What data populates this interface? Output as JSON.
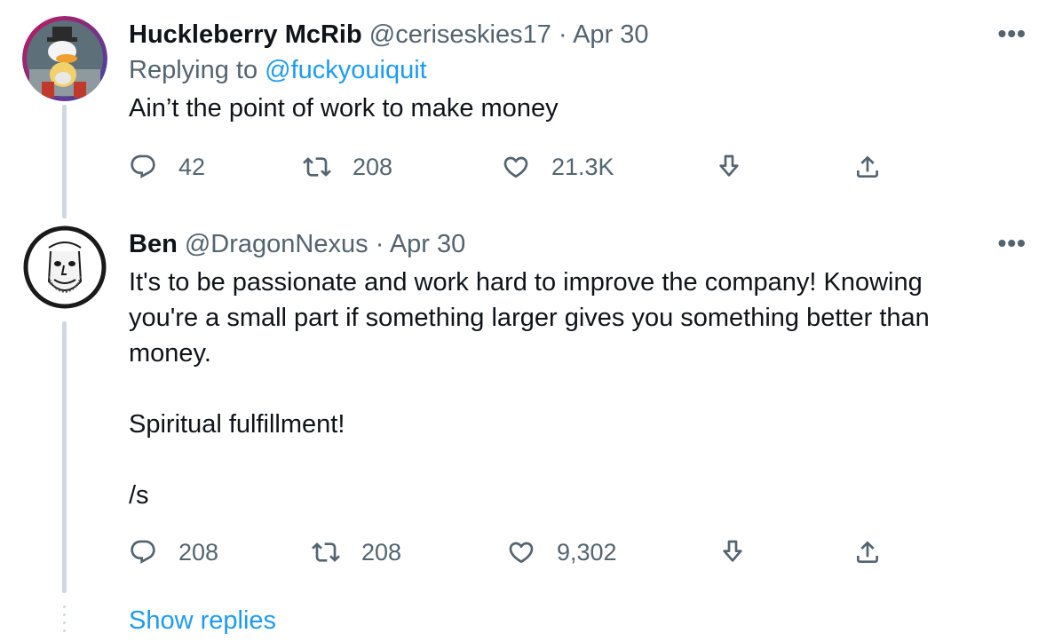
{
  "tweets": [
    {
      "name": "Huckleberry McRib",
      "handle": "@ceriseskies17",
      "date": "Apr 30",
      "replying_prefix": "Replying to",
      "replying_to": "@fuckyouiquit",
      "text": "Ain’t the point of work to make money",
      "reply_count": "42",
      "retweet_count": "208",
      "like_count": "21.3K",
      "avatar_icon": "cartoon-duck-avatar"
    },
    {
      "name": "Ben",
      "handle": "@DragonNexus",
      "date": "Apr 30",
      "text": "It's to be passionate and work hard to improve the company! Knowing\nyou're a small part if something larger gives you something better than\nmoney.\n\nSpiritual fulfillment!\n\n/s",
      "reply_count": "208",
      "retweet_count": "208",
      "like_count": "9,302",
      "avatar_icon": "sketch-face-avatar"
    }
  ],
  "separator": "·",
  "more_label": "•••",
  "show_replies": "Show replies",
  "colors": {
    "link": "#1d9bf0",
    "muted": "#536471",
    "thread_line": "#cfd9de"
  }
}
